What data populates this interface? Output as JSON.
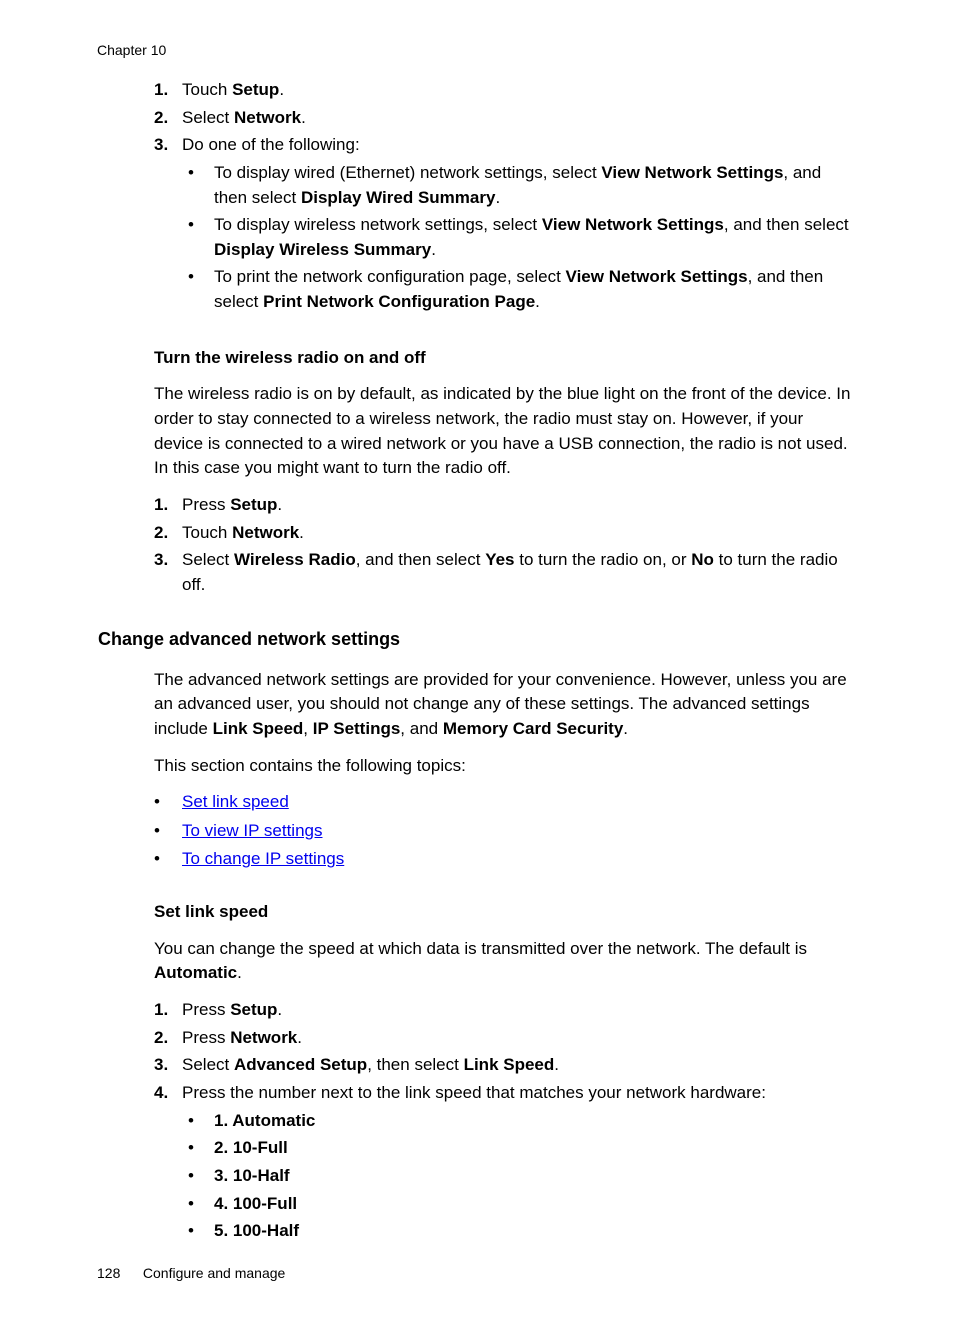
{
  "header": {
    "chapter": "Chapter 10"
  },
  "steps_a": {
    "s1_num": "1.",
    "s1_pre": "Touch ",
    "s1_b": "Setup",
    "s1_post": ".",
    "s2_num": "2.",
    "s2_pre": "Select ",
    "s2_b": "Network",
    "s2_post": ".",
    "s3_num": "3.",
    "s3_txt": "Do one of the following:",
    "b1_pre": "To display wired (Ethernet) network settings, select ",
    "b1_b1": "View Network Settings",
    "b1_mid": ", and then select ",
    "b1_b2": "Display Wired Summary",
    "b1_post": ".",
    "b2_pre": "To display wireless network settings, select ",
    "b2_b1": "View Network Settings",
    "b2_mid": ", and then select ",
    "b2_b2": "Display Wireless Summary",
    "b2_post": ".",
    "b3_pre": "To print the network configuration page, select ",
    "b3_b1": "View Network Settings",
    "b3_mid": ", and then select ",
    "b3_b2": "Print Network Configuration Page",
    "b3_post": "."
  },
  "radio": {
    "heading": "Turn the wireless radio on and off",
    "para": "The wireless radio is on by default, as indicated by the blue light on the front of the device. In order to stay connected to a wireless network, the radio must stay on. However, if your device is connected to a wired network or you have a USB connection, the radio is not used. In this case you might want to turn the radio off.",
    "s1_num": "1.",
    "s1_pre": "Press ",
    "s1_b": "Setup",
    "s1_post": ".",
    "s2_num": "2.",
    "s2_pre": "Touch ",
    "s2_b": "Network",
    "s2_post": ".",
    "s3_num": "3.",
    "s3_pre": "Select ",
    "s3_b1": "Wireless Radio",
    "s3_mid1": ", and then select ",
    "s3_b2": "Yes",
    "s3_mid2": " to turn the radio on, or ",
    "s3_b3": "No",
    "s3_post": " to turn the radio off."
  },
  "advanced": {
    "heading": "Change advanced network settings",
    "para_pre": "The advanced network settings are provided for your convenience. However, unless you are an advanced user, you should not change any of these settings. The advanced settings include ",
    "b1": "Link Speed",
    "sep1": ", ",
    "b2": "IP Settings",
    "sep2": ", and ",
    "b3": "Memory Card Security",
    "para_post": ".",
    "topics_intro": "This section contains the following topics:",
    "link1": "Set link speed",
    "link2": "To view IP settings",
    "link3": "To change IP settings"
  },
  "linkspeed": {
    "heading": "Set link speed",
    "para_pre": "You can change the speed at which data is transmitted over the network. The default is ",
    "para_b": "Automatic",
    "para_post": ".",
    "s1_num": "1.",
    "s1_pre": "Press ",
    "s1_b": "Setup",
    "s1_post": ".",
    "s2_num": "2.",
    "s2_pre": "Press ",
    "s2_b": "Network",
    "s2_post": ".",
    "s3_num": "3.",
    "s3_pre": "Select ",
    "s3_b1": "Advanced Setup",
    "s3_mid": ", then select ",
    "s3_b2": "Link Speed",
    "s3_post": ".",
    "s4_num": "4.",
    "s4_txt": "Press the number next to the link speed that matches your network hardware:",
    "opt1": "1. Automatic",
    "opt2": "2. 10-Full",
    "opt3": "3. 10-Half",
    "opt4": "4. 100-Full",
    "opt5": "5. 100-Half"
  },
  "footer": {
    "page": "128",
    "title": "Configure and manage"
  }
}
